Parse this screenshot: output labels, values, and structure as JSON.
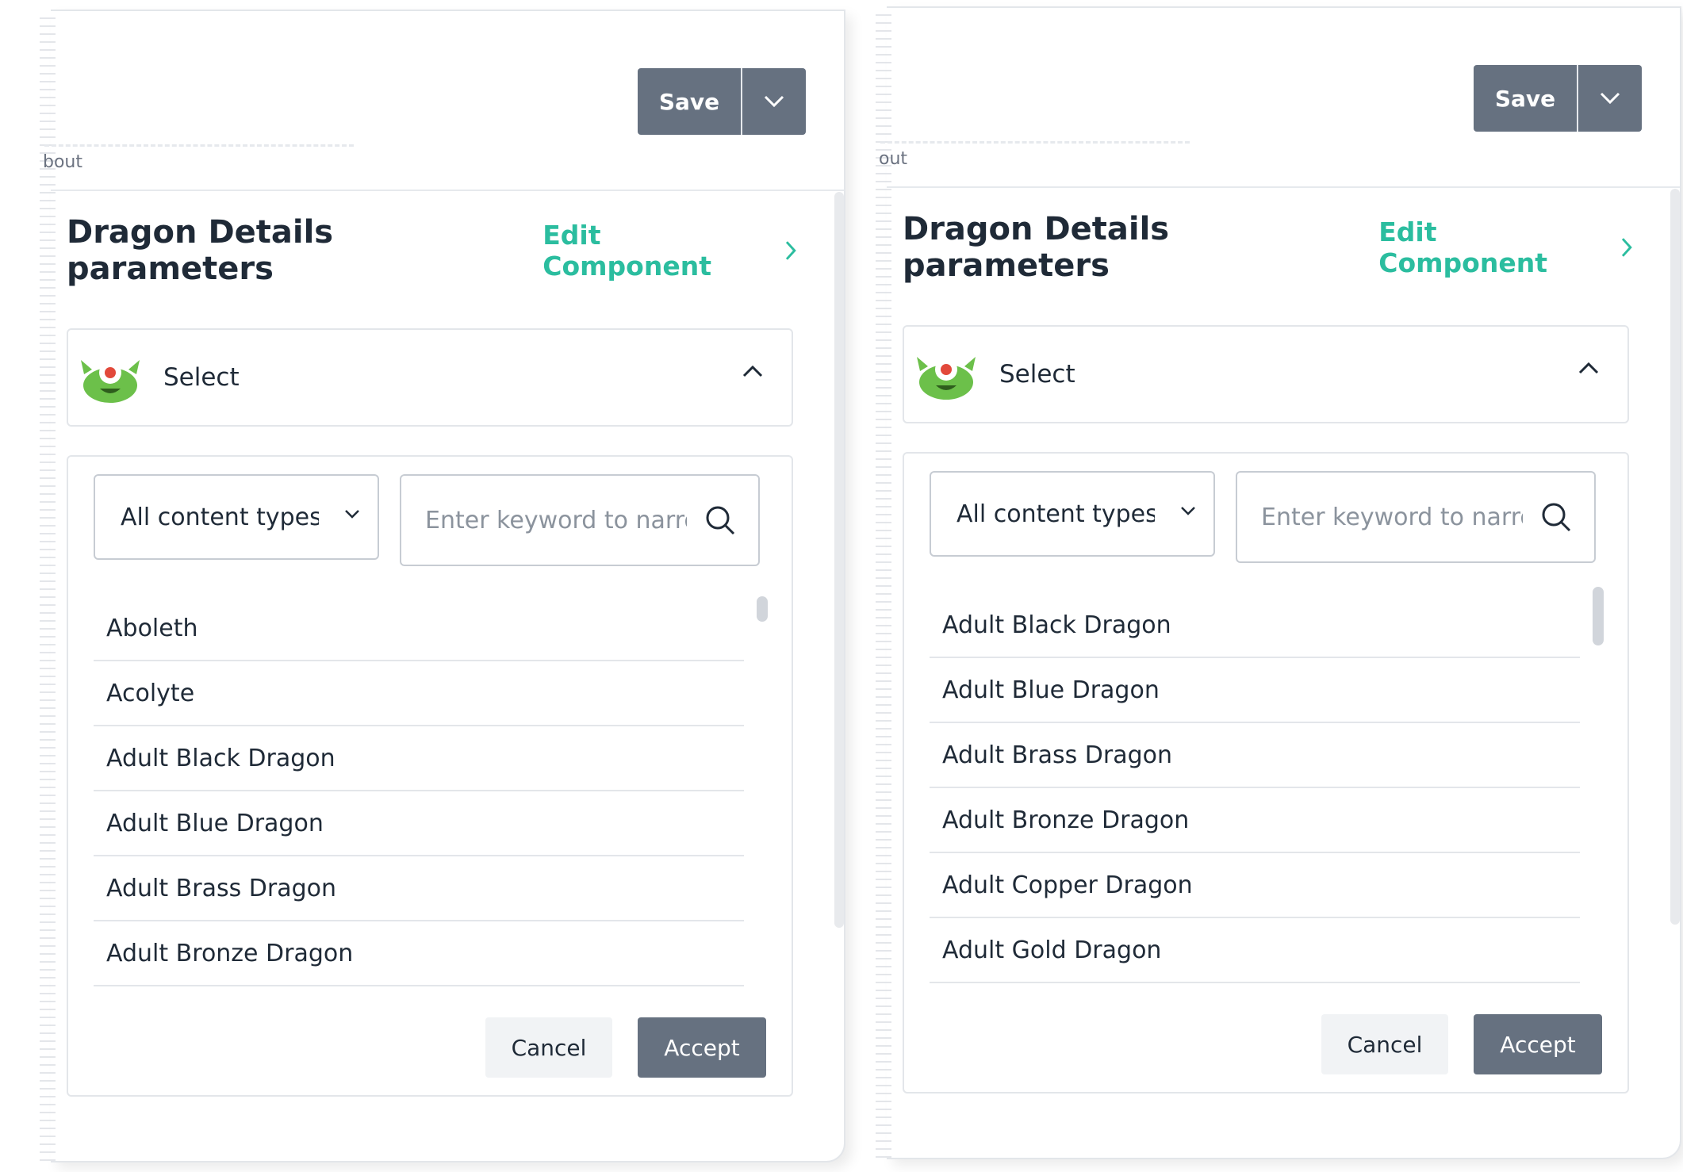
{
  "shared": {
    "save_label": "Save",
    "about_text": "bout",
    "panel_title": "Dragon Details parameters",
    "edit_component_label": "Edit Component",
    "select_label": "Select",
    "filter_value": "All content types",
    "search_placeholder": "Enter keyword to narrow",
    "cancel_label": "Cancel",
    "accept_label": "Accept",
    "accent_color": "#2bbd9f",
    "button_color": "#667180"
  },
  "left": {
    "items": [
      "Aboleth",
      "Acolyte",
      "Adult Black Dragon",
      "Adult Blue Dragon",
      "Adult Brass Dragon",
      "Adult Bronze Dragon"
    ]
  },
  "right": {
    "about_text": "out",
    "items": [
      "Adult Black Dragon",
      "Adult Blue Dragon",
      "Adult Brass Dragon",
      "Adult Bronze Dragon",
      "Adult Copper Dragon",
      "Adult Gold Dragon"
    ]
  }
}
